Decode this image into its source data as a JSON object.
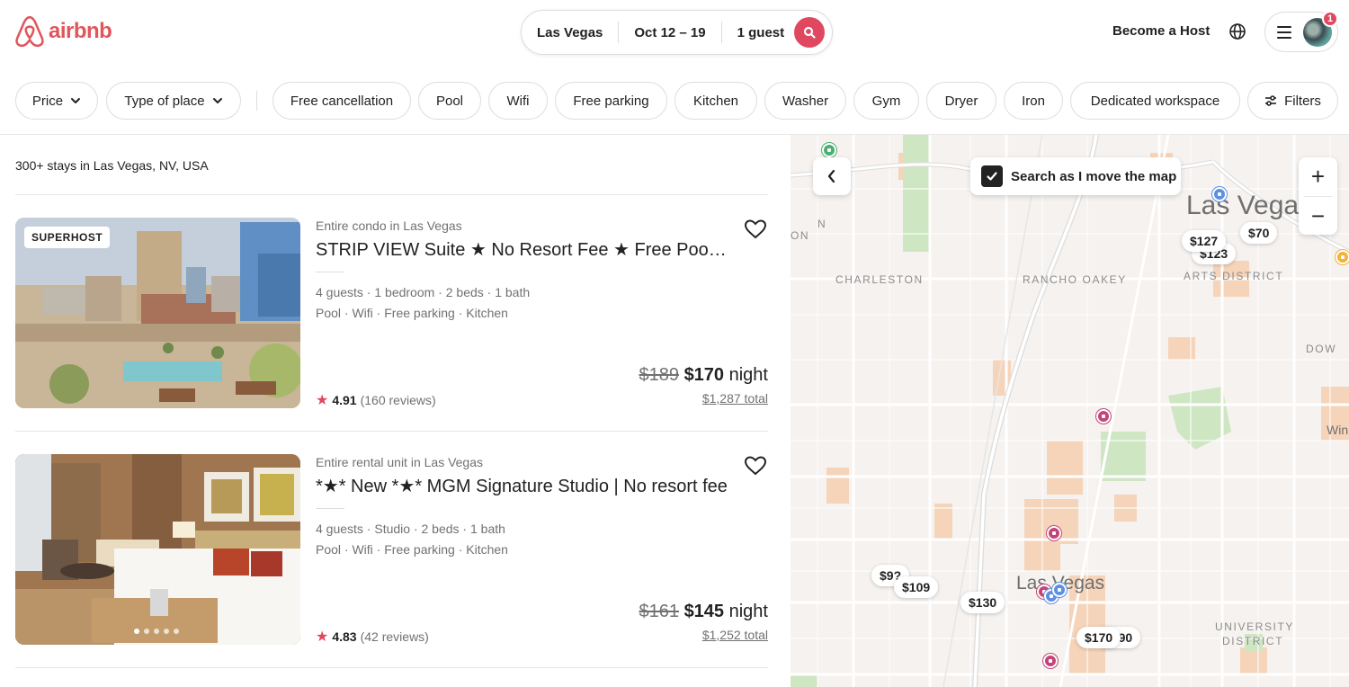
{
  "header": {
    "logo_text": "airbnb",
    "search": {
      "location": "Las Vegas",
      "dates": "Oct 12 – 19",
      "guests": "1 guest"
    },
    "become_host": "Become a Host",
    "notification_count": "1"
  },
  "filters": {
    "dropdowns": [
      {
        "label": "Price"
      },
      {
        "label": "Type of place"
      }
    ],
    "chips": [
      {
        "label": "Free cancellation"
      },
      {
        "label": "Pool"
      },
      {
        "label": "Wifi"
      },
      {
        "label": "Free parking"
      },
      {
        "label": "Kitchen"
      },
      {
        "label": "Washer"
      },
      {
        "label": "Gym"
      },
      {
        "label": "Dryer"
      },
      {
        "label": "Iron"
      },
      {
        "label": "Dedicated workspace"
      }
    ],
    "filters_button": "Filters"
  },
  "results": {
    "count_text": "300+ stays in Las Vegas, NV, USA",
    "listings": [
      {
        "badge": "SUPERHOST",
        "subtitle": "Entire condo in Las Vegas",
        "title": "STRIP VIEW Suite ★ No Resort Fee ★ Free Pool + G...",
        "details": "4 guests · 1 bedroom · 2 beds · 1 bath",
        "amenities": "Pool · Wifi · Free parking · Kitchen",
        "rating": "4.91",
        "reviews": "(160 reviews)",
        "old_price": "$189",
        "price": "$170",
        "price_unit": " night",
        "total": "$1,287 total"
      },
      {
        "subtitle": "Entire rental unit in Las Vegas",
        "title": "*★* New *★* MGM Signature Studio | No resort fee",
        "details": "4 guests · Studio · 2 beds · 1 bath",
        "amenities": "Pool · Wifi · Free parking · Kitchen",
        "rating": "4.83",
        "reviews": "(42 reviews)",
        "old_price": "$161",
        "price": "$145",
        "price_unit": " night",
        "total": "$1,252 total"
      }
    ]
  },
  "map": {
    "search_as_move": "Search as I move the map",
    "search_as_move_checked": true,
    "zoom_in": "+",
    "zoom_out": "−",
    "labels": {
      "city_top": "Las Vegas",
      "city_center": "Las Vegas",
      "charleston": "CHARLESTON",
      "rancho_oakey": "RANCHO OAKEY",
      "arts_district": "ARTS DISTRICT",
      "university_district_1": "UNIVERSITY",
      "university_district_2": "DISTRICT",
      "downtown_fragment": "DOW",
      "edge_n": "N",
      "edge_on": "ON",
      "win_fragment": "Win"
    },
    "price_pins": [
      {
        "label": "$127"
      },
      {
        "label": "$123"
      },
      {
        "label": "$70"
      },
      {
        "label": "$9?"
      },
      {
        "label": "$109"
      },
      {
        "label": "$130"
      },
      {
        "label": "$170"
      },
      {
        "label": "$190"
      }
    ]
  },
  "colors": {
    "brand": "#E0485F",
    "text_primary": "#222222",
    "text_secondary": "#717171",
    "map_bg": "#F5F2EF"
  }
}
